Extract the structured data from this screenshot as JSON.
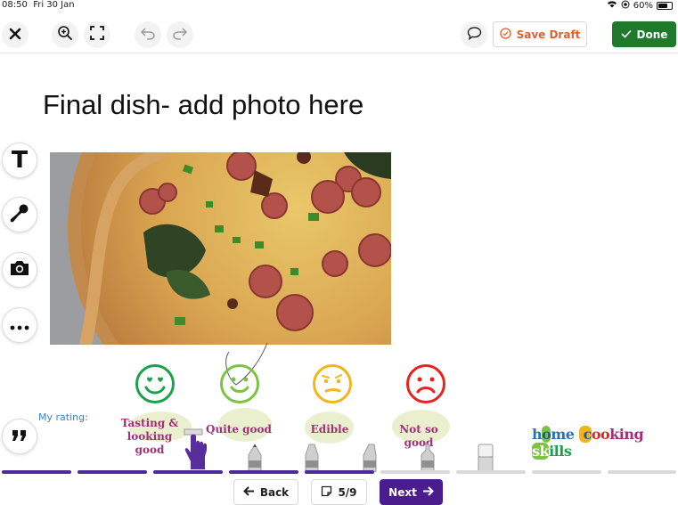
{
  "status": {
    "time": "08:50",
    "date": "Fri 30 Jan",
    "battery": "60%"
  },
  "toolbar": {
    "save_draft_label": "Save Draft",
    "done_label": "Done"
  },
  "page_title": "Final dish- add photo here",
  "rating": {
    "label": "My rating:",
    "options": [
      {
        "label_line1": "Tasting &",
        "label_line2": "looking good",
        "color": "#1aa14a"
      },
      {
        "label_line1": "Quite good",
        "label_line2": "",
        "color": "#7cc243"
      },
      {
        "label_line1": "Edible",
        "label_line2": "",
        "color": "#f2b51d"
      },
      {
        "label_line1": "Not so good",
        "label_line2": "",
        "color": "#e52421"
      }
    ]
  },
  "progress": {
    "current": 5,
    "total": 9,
    "page_label": "5/9"
  },
  "nav": {
    "back_label": "Back",
    "next_label": "Next"
  },
  "logo_text": "home cooking skills",
  "colors": {
    "accent": "#4a1d8c",
    "done_green": "#1f7a2b",
    "save_orange": "#e0622a"
  }
}
